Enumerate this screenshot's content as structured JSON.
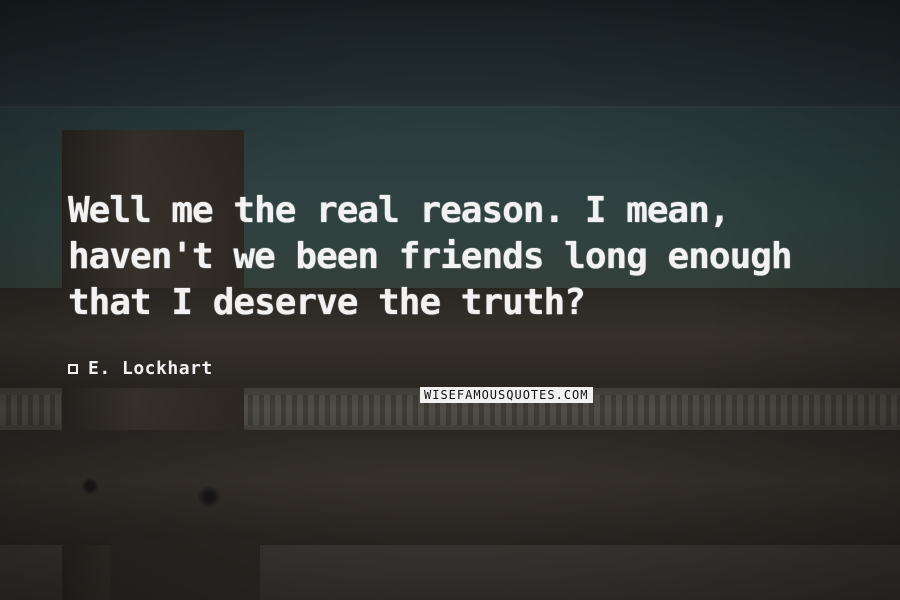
{
  "quote": {
    "text": "Well me the real reason. I mean, haven't we been friends long enough that I deserve the truth?"
  },
  "author": {
    "name": "E. Lockhart"
  },
  "watermark": {
    "text": "WISEFAMOUSQUOTES.COM"
  },
  "colors": {
    "text": "#f2f2f2",
    "watermark_bg": "#f1f1f1"
  }
}
